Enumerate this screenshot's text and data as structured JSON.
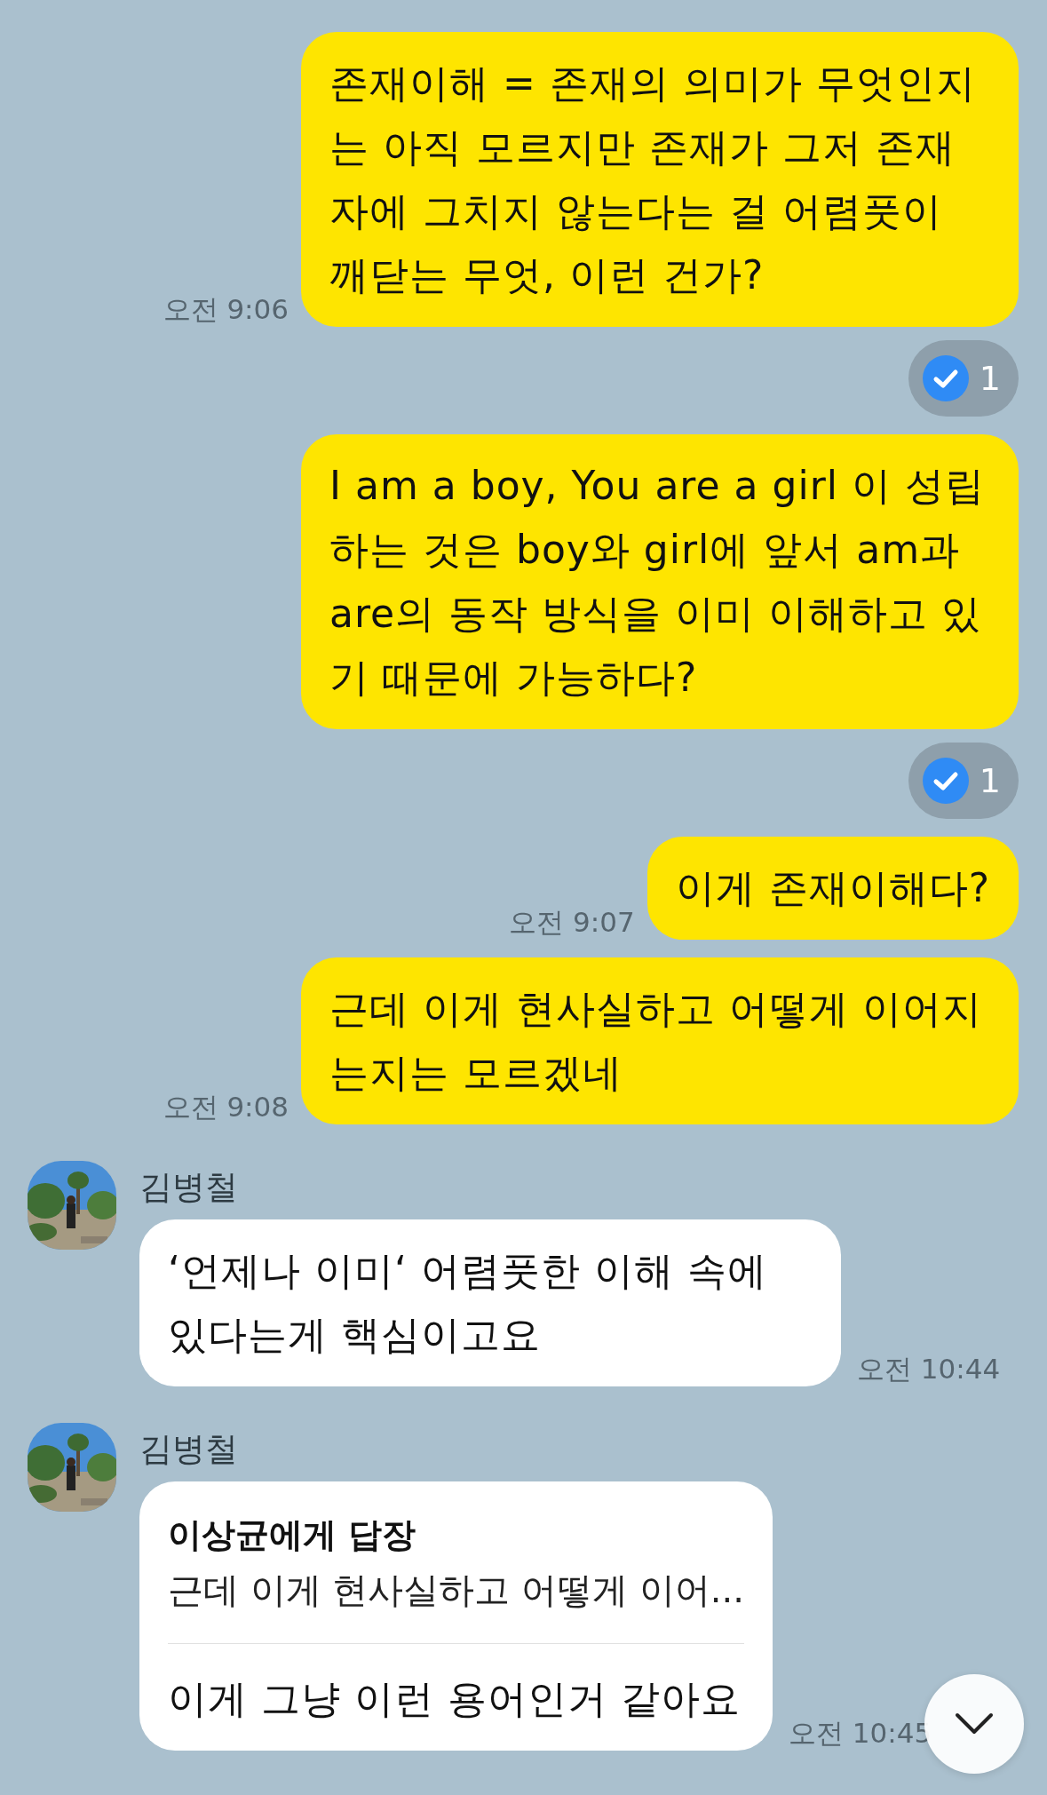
{
  "messages": [
    {
      "kind": "outgoing",
      "text": "존재이해 = 존재의 의미가 무엇인지는 아직 모르지만 존재가 그저 존재자에 그치지 않는다는 걸 어렴풋이 깨닫는 무엇, 이런 건가?",
      "time": "오전 9:06",
      "reaction": "1"
    },
    {
      "kind": "outgoing",
      "text": "I am a boy, You are a girl 이 성립하는 것은 boy와 girl에 앞서 am과 are의 동작 방식을 이미 이해하고 있기 때문에 가능하다?",
      "reaction": "1"
    },
    {
      "kind": "outgoing",
      "text": "이게 존재이해다?",
      "time": "오전 9:07"
    },
    {
      "kind": "outgoing",
      "text": "근데 이게 현사실하고 어떻게 이어지는지는 모르겠네",
      "time": "오전 9:08"
    },
    {
      "kind": "incoming",
      "sender": "김병철",
      "text": "‘언제나 이미‘ 어렴풋한 이해 속에 있다는게 핵심이고요",
      "time": "오전 10:44"
    },
    {
      "kind": "incoming",
      "sender": "김병철",
      "reply": {
        "title": "이상균에게 답장",
        "quote": "근데 이게 현사실하고 어떻게 이어..."
      },
      "text": "이게 그냥 이런 용어인거 같아요",
      "time": "오전 10:45"
    }
  ]
}
